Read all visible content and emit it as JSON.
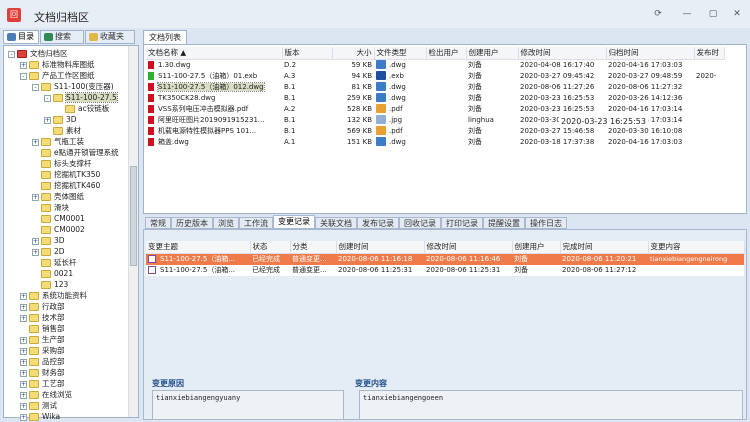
{
  "app": {
    "title": "文档归档区",
    "logo_text": "回"
  },
  "window_controls": [
    "restore",
    "minimize",
    "maximize",
    "close"
  ],
  "left_tabs": [
    {
      "label": "目录",
      "icon": "monitor-icon",
      "color": "#4a7fb5"
    },
    {
      "label": "搜索",
      "icon": "search-icon",
      "color": "#2e8b57"
    },
    {
      "label": "收藏夹",
      "icon": "favorites-icon",
      "color": "#e0b84a"
    }
  ],
  "tree": [
    {
      "label": "文档归档区",
      "lvl": 0,
      "pm": "-",
      "root": true
    },
    {
      "label": "标准物料库图纸",
      "lvl": 1,
      "pm": "+"
    },
    {
      "label": "产品工作区图纸",
      "lvl": 1,
      "pm": "-"
    },
    {
      "label": "S11-100(变压器)",
      "lvl": 2,
      "pm": "-"
    },
    {
      "label": "S11-100-27.5",
      "lvl": 3,
      "pm": "-",
      "sel": true
    },
    {
      "label": "ac铰链板",
      "lvl": 4,
      "pm": ""
    },
    {
      "label": "3D",
      "lvl": 3,
      "pm": "+"
    },
    {
      "label": "素材",
      "lvl": 3,
      "pm": ""
    },
    {
      "label": "气瓶工装",
      "lvl": 2,
      "pm": "+"
    },
    {
      "label": "e點通开锁管理系统",
      "lvl": 2,
      "pm": ""
    },
    {
      "label": "标头支撑杆",
      "lvl": 2,
      "pm": ""
    },
    {
      "label": "挖掘机TK350",
      "lvl": 2,
      "pm": ""
    },
    {
      "label": "挖掘机TK460",
      "lvl": 2,
      "pm": ""
    },
    {
      "label": "壳体图纸",
      "lvl": 2,
      "pm": "+"
    },
    {
      "label": "滑块",
      "lvl": 2,
      "pm": ""
    },
    {
      "label": "CM0001",
      "lvl": 2,
      "pm": ""
    },
    {
      "label": "CM0002",
      "lvl": 2,
      "pm": ""
    },
    {
      "label": "3D",
      "lvl": 2,
      "pm": "+"
    },
    {
      "label": "2D",
      "lvl": 2,
      "pm": "+"
    },
    {
      "label": "延长杆",
      "lvl": 2,
      "pm": ""
    },
    {
      "label": "0021",
      "lvl": 2,
      "pm": ""
    },
    {
      "label": "123",
      "lvl": 2,
      "pm": ""
    },
    {
      "label": "系统功能资料",
      "lvl": 1,
      "pm": "+"
    },
    {
      "label": "行政部",
      "lvl": 1,
      "pm": "+"
    },
    {
      "label": "技术部",
      "lvl": 1,
      "pm": "+"
    },
    {
      "label": "销售部",
      "lvl": 1,
      "pm": ""
    },
    {
      "label": "生产部",
      "lvl": 1,
      "pm": "+"
    },
    {
      "label": "采购部",
      "lvl": 1,
      "pm": "+"
    },
    {
      "label": "品控部",
      "lvl": 1,
      "pm": "+"
    },
    {
      "label": "财务部",
      "lvl": 1,
      "pm": "+"
    },
    {
      "label": "工艺部",
      "lvl": 1,
      "pm": "+"
    },
    {
      "label": "在线浏览",
      "lvl": 1,
      "pm": "+"
    },
    {
      "label": "测试",
      "lvl": 1,
      "pm": "+"
    },
    {
      "label": "Wika",
      "lvl": 1,
      "pm": "+"
    }
  ],
  "doclist": {
    "tab": "文档列表",
    "columns": [
      "文档名称 ▲",
      "版本",
      "大小",
      "文件类型",
      "检出用户",
      "创建用户",
      "修改时间",
      "归档时间",
      "发布时"
    ],
    "rows": [
      {
        "name": "1.30.dwg",
        "ver": "D.2",
        "size": "59 KB",
        "type": ".dwg",
        "out": "",
        "user": "刘备",
        "mod": "2020-04-08 16:17:40",
        "arch": "2020-04-16 17:03:03",
        "pub": "",
        "flag": "#d01020",
        "ticon": "#3d7cc9"
      },
      {
        "name": "S11-100-27.5（油箱）01.exb",
        "ver": "A.3",
        "size": "94 KB",
        "type": ".exb",
        "out": "",
        "user": "刘备",
        "mod": "2020-03-27 09:45:42",
        "arch": "2020-03-27 09:48:59",
        "pub": "2020-",
        "flag": "#30b030",
        "ticon": "#1c4fa0"
      },
      {
        "name": "S11-100-27.5（油箱）012.dwg",
        "ver": "B.1",
        "size": "81 KB",
        "type": ".dwg",
        "out": "",
        "user": "刘备",
        "mod": "2020-08-06 11:27:26",
        "arch": "2020-08-06 11:27:32",
        "pub": "",
        "flag": "#d01020",
        "ticon": "#3d7cc9",
        "sel": true
      },
      {
        "name": "TK350CK28.dwg",
        "ver": "B.1",
        "size": "259 KB",
        "type": ".dwg",
        "out": "",
        "user": "刘备",
        "mod": "2020-03-23 16:25:53",
        "arch": "2020-03-26 14:12:36",
        "pub": "",
        "flag": "#d01020",
        "ticon": "#3d7cc9"
      },
      {
        "name": "VSS系列电压冲击模拟器.pdf",
        "ver": "A.2",
        "size": "528 KB",
        "type": ".pdf",
        "out": "",
        "user": "刘备",
        "mod": "2020-03-23 16:25:53",
        "arch": "2020-04-16 17:03:14",
        "pub": "",
        "flag": "#d01020",
        "ticon": "#e8a030"
      },
      {
        "name": "阿里旺旺图片2019091915231...",
        "ver": "B.1",
        "size": "132 KB",
        "type": ".jpg",
        "out": "",
        "user": "linghua",
        "mod": "2020-03-30 15:09:29",
        "arch": "2020-04-16 17:03:14",
        "pub": "",
        "flag": "#d01020",
        "ticon": "#8fb0d0"
      },
      {
        "name": "机载电源特性模拟器PPS 101...",
        "ver": "B.1",
        "size": "569 KB",
        "type": ".pdf",
        "out": "",
        "user": "刘备",
        "mod": "2020-03-27 15:46:58",
        "arch": "2020-03-30 16:10:08",
        "pub": "",
        "flag": "#d01020",
        "ticon": "#e8a030"
      },
      {
        "name": "箱盖.dwg",
        "ver": "A.1",
        "size": "151 KB",
        "type": ".dwg",
        "out": "",
        "user": "刘备",
        "mod": "2020-03-18 17:37:38",
        "arch": "2020-04-16 17:03:03",
        "pub": "",
        "flag": "#d01020",
        "ticon": "#3d7cc9"
      }
    ],
    "tooltip": "2020-03-23 16:25:53"
  },
  "bottom_tabs": [
    "常规",
    "历史版本",
    "浏览",
    "工作流",
    "变更记录",
    "关联文档",
    "发布记录",
    "回收记录",
    "打印记录",
    "提醒设置",
    "操作日志"
  ],
  "active_bottom_tab": 4,
  "changes": {
    "columns": [
      "变更主题",
      "状态",
      "分类",
      "创建时间",
      "修改时间",
      "创建用户",
      "完成时间",
      "变更内容"
    ],
    "rows": [
      {
        "subject": "S11-100-27.5（油箱...",
        "status": "已经完成",
        "cat": "普通变更...",
        "created": "2020-08-06 11:16:18",
        "modified": "2020-08-06 11:16:46",
        "user": "刘备",
        "done": "2020-08-06 11:20:21",
        "content": "tianxiebiangengneirong",
        "hl": true
      },
      {
        "subject": "S11-100-27.5（油箱...",
        "status": "已经完成",
        "cat": "普通变更...",
        "created": "2020-08-06 11:25:31",
        "modified": "2020-08-06 11:25:31",
        "user": "刘备",
        "done": "2020-08-06 11:27:12",
        "content": ""
      }
    ],
    "reason_label": "变更原因",
    "reason_value": "tianxiebiangengyuany",
    "content_label": "变更内容",
    "content_value": "tianxiebiangengoeen"
  }
}
